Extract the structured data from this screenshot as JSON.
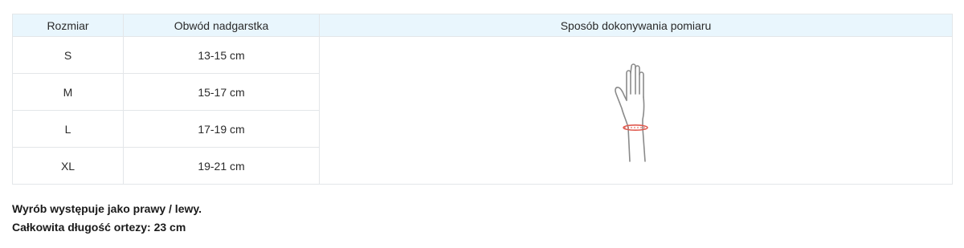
{
  "table": {
    "headers": {
      "size": "Rozmiar",
      "circumference": "Obwód nadgarstka",
      "method": "Sposób dokonywania pomiaru"
    },
    "rows": [
      {
        "size": "S",
        "circumference": "13-15 cm"
      },
      {
        "size": "M",
        "circumference": "15-17 cm"
      },
      {
        "size": "L",
        "circumference": "17-19 cm"
      },
      {
        "size": "XL",
        "circumference": "19-21 cm"
      }
    ],
    "illustration_icon": "hand-wrist-measurement-icon",
    "colors": {
      "header_background": "#e9f6fd",
      "border": "#e3e6e9",
      "measure_line": "#e05a4f",
      "hand_outline": "#8a8a8a"
    }
  },
  "notes": {
    "line1": "Wyrób występuje jako prawy / lewy.",
    "line2": "Całkowita długość ortezy: 23 cm"
  }
}
